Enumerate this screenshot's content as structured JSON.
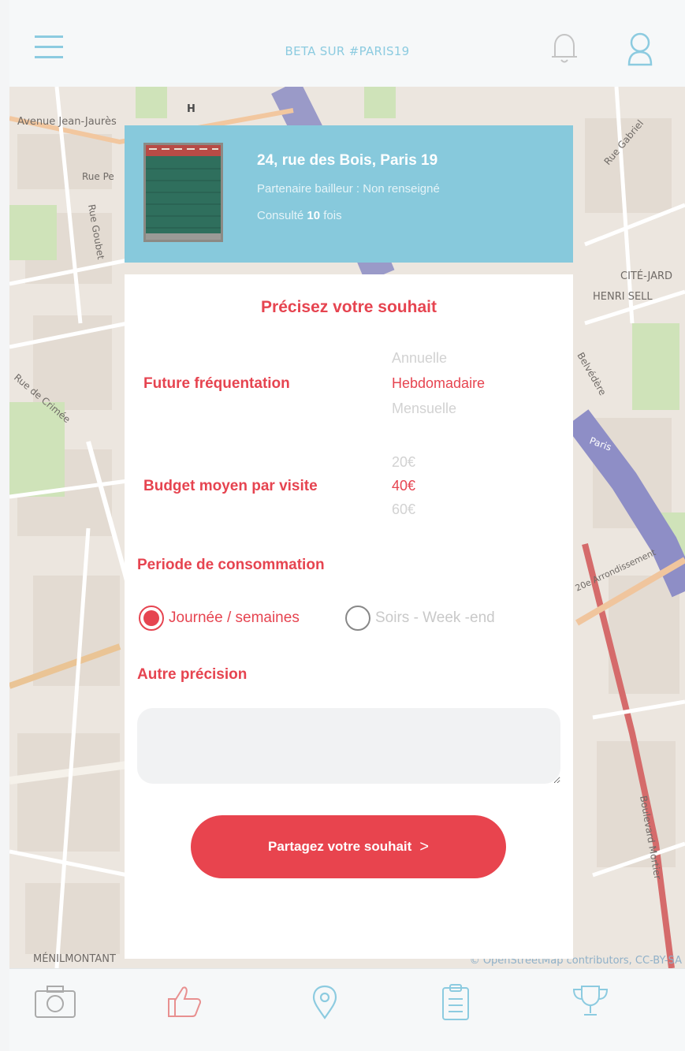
{
  "topbar": {
    "title": "BETA SUR #PARIS19"
  },
  "map": {
    "attribution": "© OpenStreetMap contributors, CC-BY-SA",
    "labels": [
      "Avenue Jean-Jaurès",
      "H",
      "Rue Pe",
      "Rue Goubet",
      "Rue de Crimée",
      "CITÉ-JARD",
      "HENRI SELL",
      "Belvédère",
      "Paris",
      "20e Arrondissement",
      "Boulevard Mortier",
      "MÉNILMONTANT",
      "Rue Gabriel"
    ]
  },
  "listing": {
    "address": "24, rue des Bois, Paris 19",
    "partner": "Partenaire bailleur : Non renseigné",
    "consult_prefix": "Consulté",
    "consult_count": "10",
    "consult_suffix": "fois"
  },
  "form": {
    "heading": "Précisez votre souhait",
    "frequency": {
      "label": "Future fréquentation",
      "options": [
        "Annuelle",
        "Hebdomadaire",
        "Mensuelle"
      ],
      "selected": "Hebdomadaire"
    },
    "budget": {
      "label": "Budget moyen par visite",
      "options": [
        "20€",
        "40€",
        "60€"
      ],
      "selected": "40€"
    },
    "period": {
      "label": "Periode de consommation",
      "option1": "Journée / semaines",
      "option2": "Soirs - Week -end",
      "selected": "Journée / semaines"
    },
    "other": {
      "label": "Autre précision",
      "value": "",
      "placeholder": ""
    },
    "submit_label": "Partagez votre souhait",
    "submit_chevron": ">"
  },
  "colors": {
    "accent": "#e64450",
    "header_blue": "#87c9dc",
    "icon_blue": "#8ccbe0"
  },
  "icons": {
    "menu": "menu-icon",
    "notifications": "bell-icon",
    "profile": "user-icon",
    "camera": "camera-icon",
    "like": "thumbs-up-icon",
    "location": "location-pin-icon",
    "clipboard": "clipboard-icon",
    "trophy": "trophy-icon"
  }
}
